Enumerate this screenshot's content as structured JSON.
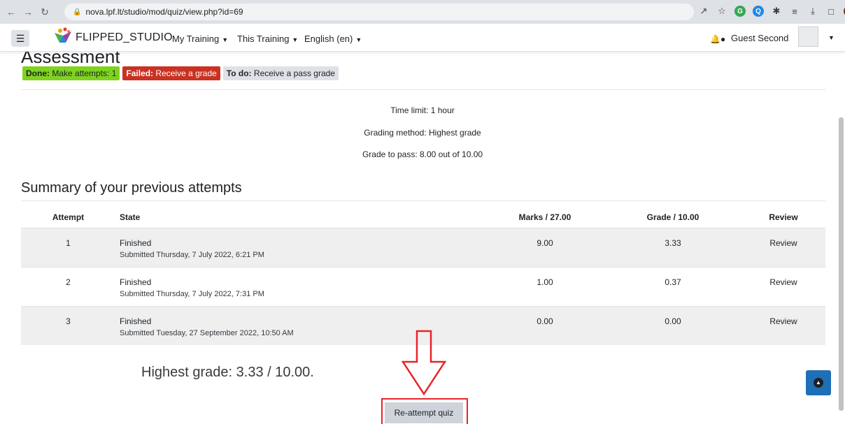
{
  "browser": {
    "url": "nova.lpf.lt/studio/mod/quiz/view.php?id=69",
    "back_icon": "arrow-left",
    "forward_icon": "arrow-right",
    "reload_icon": "reload"
  },
  "navbar": {
    "brand": "FLIPPED_STUDIO",
    "menus": [
      {
        "label": "My Training"
      },
      {
        "label": "This Training"
      },
      {
        "label": "English (en)"
      }
    ],
    "user_name": "Guest Second"
  },
  "page": {
    "heading": "Assessment",
    "completion": [
      {
        "status": "Done:",
        "text": "Make attempts: 1",
        "color": "#7fd320"
      },
      {
        "status": "Failed:",
        "text": "Receive a grade",
        "color": "#ca3120"
      },
      {
        "status": "To do:",
        "text": "Receive a pass grade",
        "color": "#dee2e6"
      }
    ],
    "info": {
      "time_limit": "Time limit: 1 hour",
      "grading_method": "Grading method: Highest grade",
      "grade_to_pass": "Grade to pass: 8.00 out of 10.00"
    },
    "summary_title": "Summary of your previous attempts",
    "table": {
      "headers": {
        "attempt": "Attempt",
        "state": "State",
        "marks": "Marks / 27.00",
        "grade": "Grade / 10.00",
        "review": "Review"
      },
      "rows": [
        {
          "attempt": "1",
          "state": "Finished",
          "submitted": "Submitted Thursday, 7 July 2022, 6:21 PM",
          "marks": "9.00",
          "grade": "3.33",
          "review": "Review"
        },
        {
          "attempt": "2",
          "state": "Finished",
          "submitted": "Submitted Thursday, 7 July 2022, 7:31 PM",
          "marks": "1.00",
          "grade": "0.37",
          "review": "Review"
        },
        {
          "attempt": "3",
          "state": "Finished",
          "submitted": "Submitted Tuesday, 27 September 2022, 10:50 AM",
          "marks": "0.00",
          "grade": "0.00",
          "review": "Review"
        }
      ]
    },
    "highest_grade": "Highest grade: 3.33 / 10.00.",
    "reattempt_label": "Re-attempt quiz"
  },
  "colors": {
    "annotation": "#e8232a",
    "back_to_top": "#1f6fb7"
  }
}
